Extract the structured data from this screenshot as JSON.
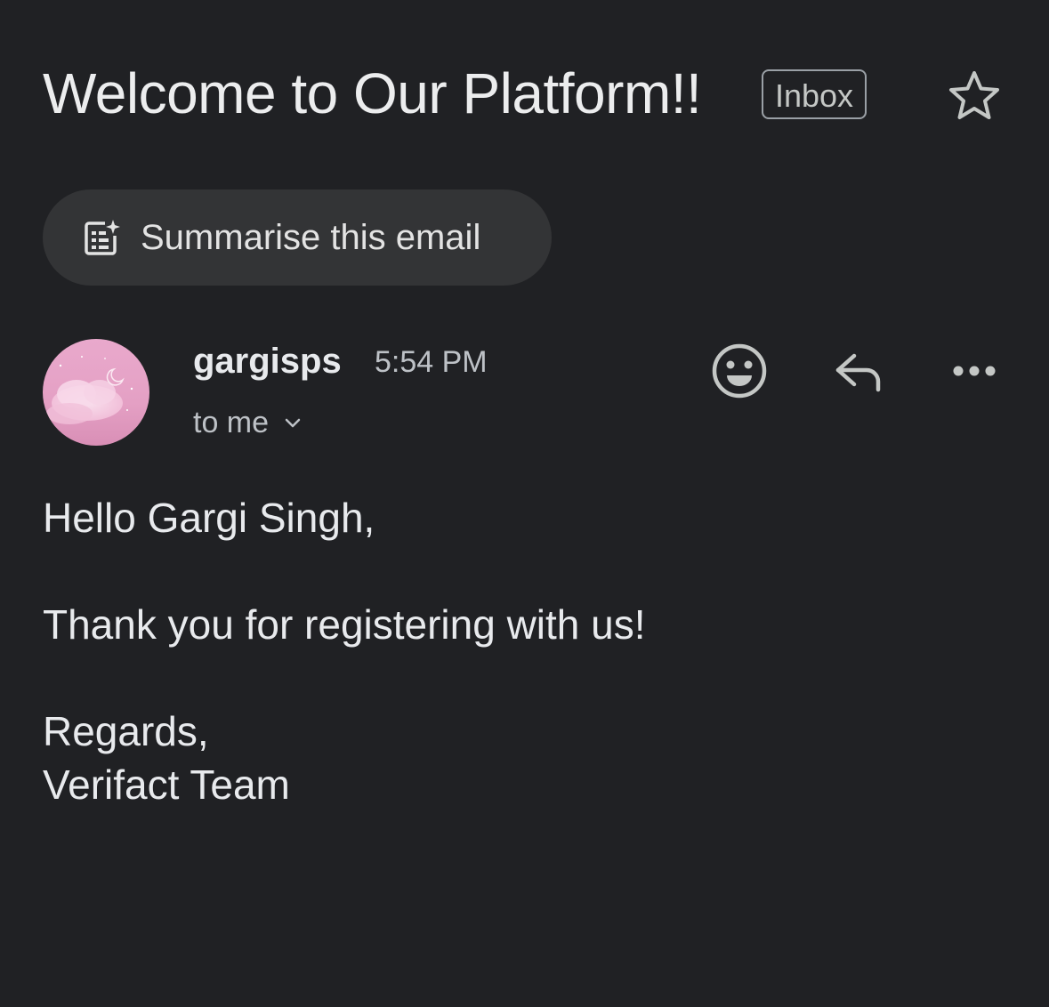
{
  "email": {
    "subject": "Welcome to Our Platform!!",
    "label": "Inbox",
    "star_icon": "star-outline-icon"
  },
  "summarise": {
    "label": "Summarise this email",
    "icon": "summarise-sparkle-icon"
  },
  "sender": {
    "name": "gargisps",
    "time": "5:54 PM",
    "recipient": "to me",
    "avatar": "pink-cloud-moon-avatar"
  },
  "actions": {
    "react_icon": "emoji-smile-icon",
    "reply_icon": "reply-icon",
    "more_icon": "more-horizontal-icon"
  },
  "body": {
    "greeting": "Hello Gargi Singh,",
    "message": "Thank you for registering with us!",
    "closing": "Regards,",
    "signature": "Verifact Team"
  },
  "colors": {
    "background": "#202124",
    "chip_background": "#333436",
    "text_primary": "#e8eaed",
    "text_secondary": "#bdc1c6"
  }
}
